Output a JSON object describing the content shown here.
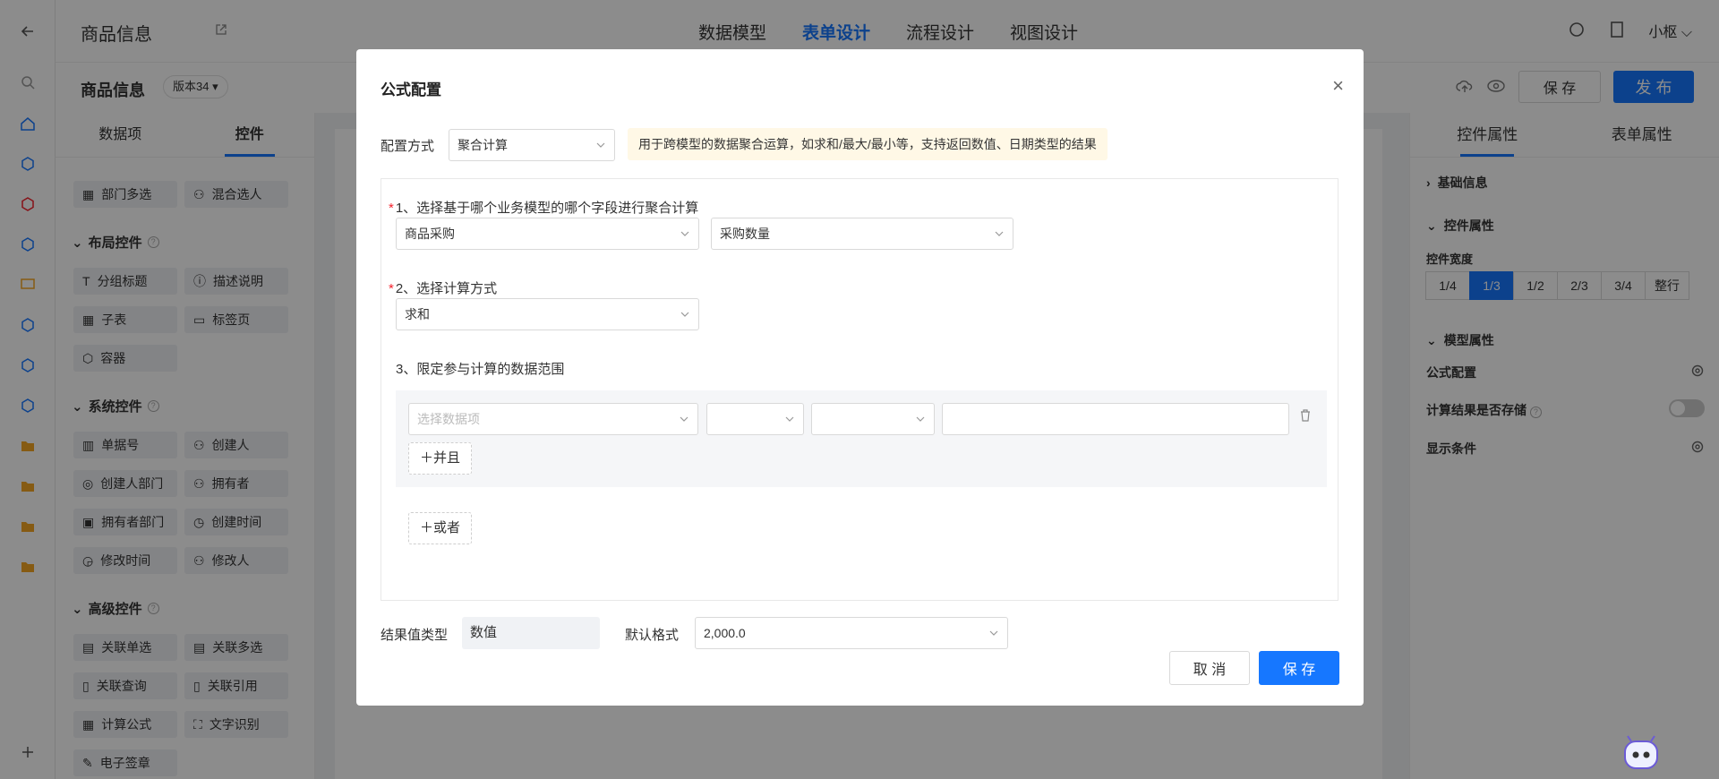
{
  "app": {
    "title": "商品信息"
  },
  "top_tabs": [
    "数据模型",
    "表单设计",
    "流程设计",
    "视图设计"
  ],
  "top_tab_active": "表单设计",
  "user": {
    "name": "小枢"
  },
  "form": {
    "title": "商品信息",
    "version": "版本34"
  },
  "actions": {
    "save": "保 存",
    "publish": "发 布"
  },
  "left_panel": {
    "tabs": [
      "数据项",
      "控件"
    ],
    "partial_items": [
      "部门多选",
      "混合选人"
    ],
    "layout_section": {
      "title": "布局控件",
      "items": [
        "分组标题",
        "描述说明",
        "子表",
        "标签页",
        "容器"
      ]
    },
    "system_section": {
      "title": "系统控件",
      "items": [
        "单据号",
        "创建人",
        "创建人部门",
        "拥有者",
        "拥有者部门",
        "创建时间",
        "修改时间",
        "修改人"
      ]
    },
    "advanced_section": {
      "title": "高级控件",
      "items": [
        "关联单选",
        "关联多选",
        "关联查询",
        "关联引用",
        "计算公式",
        "文字识别",
        "电子签章"
      ]
    }
  },
  "right_panel": {
    "tabs": [
      "控件属性",
      "表单属性"
    ],
    "basic_info": "基础信息",
    "control_props": "控件属性",
    "width_label": "控件宽度",
    "width_options": [
      "1/4",
      "1/3",
      "1/2",
      "2/3",
      "3/4",
      "整行"
    ],
    "width_selected": "1/3",
    "model_props": "模型属性",
    "formula_config": "公式配置",
    "store_result": "计算结果是否存储",
    "store_result_on": false,
    "display_condition": "显示条件"
  },
  "modal": {
    "title": "公式配置",
    "config_mode_label": "配置方式",
    "config_mode_value": "聚合计算",
    "hint": "用于跨模型的数据聚合运算，如求和/最大/最小等，支持返回数值、日期类型的结果",
    "step1": "1、选择基于哪个业务模型的哪个字段进行聚合计算",
    "model_value": "商品采购",
    "field_value": "采购数量",
    "step2": "2、选择计算方式",
    "calc_value": "求和",
    "step3": "3、限定参与计算的数据范围",
    "filter_placeholder": "选择数据项",
    "and_button": "并且",
    "or_button": "或者",
    "result_type_label": "结果值类型",
    "result_type_value": "数值",
    "default_format_label": "默认格式",
    "default_format_value": "2,000.0",
    "cancel": "取 消",
    "save": "保 存"
  },
  "colors": {
    "primary": "#1677ff",
    "required": "#f5222d",
    "hint_bg": "#fff8e6"
  }
}
